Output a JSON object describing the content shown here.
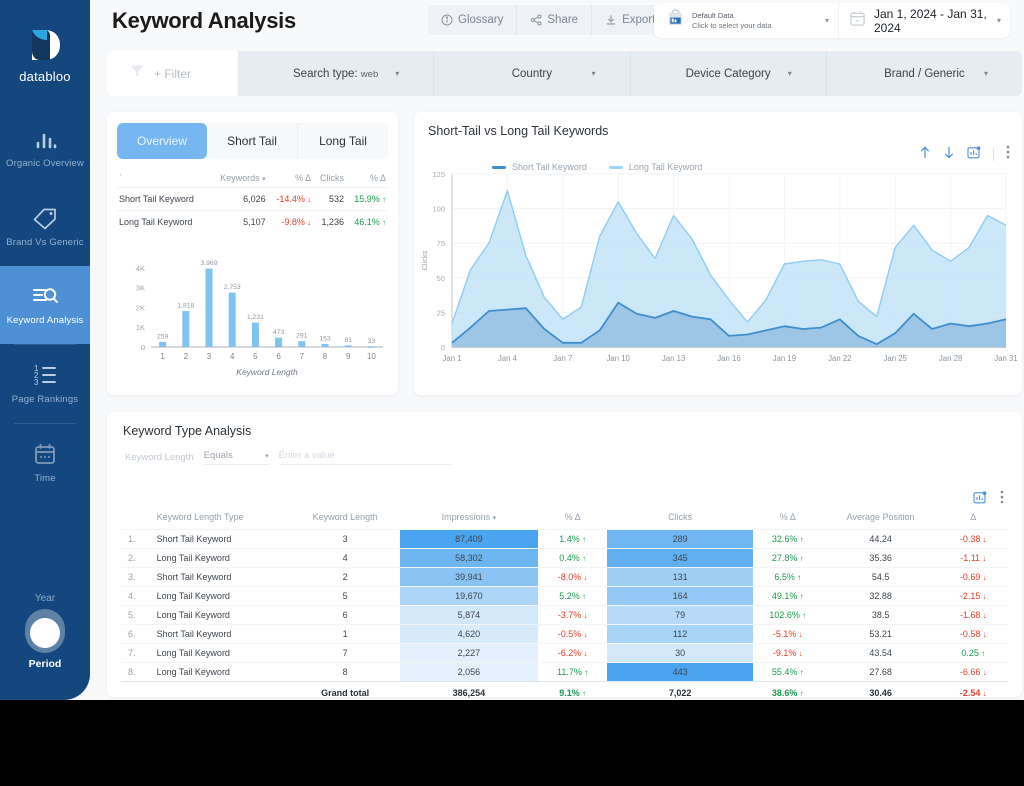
{
  "brand": {
    "name": "databloo",
    "logo_icon": "databloo-logo-icon"
  },
  "sidebar": {
    "items": [
      {
        "label": "Organic Overview",
        "icon": "bar-chart-icon",
        "active": false
      },
      {
        "label": "Brand Vs Generic",
        "icon": "tag-icon",
        "active": false
      },
      {
        "label": "Keyword Analysis",
        "icon": "keyword-search-icon",
        "active": true
      },
      {
        "label": "Page Rankings",
        "icon": "numbered-list-icon",
        "active": false
      },
      {
        "label": "Time",
        "icon": "calendar-icon",
        "active": false
      }
    ],
    "period": {
      "year_label": "Year",
      "period_label": "Period",
      "toggle_icon": "toggle-switch-icon"
    }
  },
  "header": {
    "title": "Keyword Analysis",
    "actions": [
      {
        "label": "Glossary",
        "icon": "info-circle-icon"
      },
      {
        "label": "Share",
        "icon": "share-icon"
      },
      {
        "label": "Export",
        "icon": "download-icon"
      }
    ],
    "data_source": {
      "icon": "data-source-icon",
      "title": "Default Data",
      "subtitle": "Click to select your data",
      "caret": "▾"
    },
    "date_range": {
      "icon": "calendar-icon",
      "value": "Jan 1, 2024 - Jan 31, 2024",
      "caret": "▾"
    }
  },
  "filter_bar": {
    "filter_chip": {
      "label": "+ Filter",
      "icon": "funnel-icon"
    },
    "segments": [
      {
        "label": "Search type:",
        "value": "web",
        "caret": "▾"
      },
      {
        "label": "Country",
        "value": "",
        "caret": "▾"
      },
      {
        "label": "Device Category",
        "value": "",
        "caret": "▾"
      },
      {
        "label": "Brand / Generic",
        "value": "",
        "caret": "▾"
      }
    ]
  },
  "left_card": {
    "tabs": [
      {
        "label": "Overview",
        "active": true
      },
      {
        "label": "Short Tail",
        "active": false
      },
      {
        "label": "Long Tail",
        "active": false
      }
    ],
    "summary_table": {
      "columns": [
        "",
        "Keywords",
        "% Δ",
        "Clicks",
        "% Δ"
      ],
      "sort_col": "Keywords",
      "rows": [
        {
          "type": "Short Tail Keyword",
          "keywords": "6,026",
          "kw_delta": "-14.4%",
          "kw_dir": "down",
          "clicks": "532",
          "clicks_delta": "15.9%",
          "clicks_dir": "up"
        },
        {
          "type": "Long Tail Keyword",
          "keywords": "5,107",
          "kw_delta": "-9.8%",
          "kw_dir": "down",
          "clicks": "1,236",
          "clicks_delta": "46.1%",
          "clicks_dir": "up"
        }
      ]
    }
  },
  "right_card": {
    "title": "Short-Tail vs Long Tail Keywords",
    "tools": [
      {
        "icon": "arrow-up-icon"
      },
      {
        "icon": "arrow-down-icon"
      },
      {
        "icon": "chart-export-icon"
      },
      {
        "icon": "more-vertical-icon"
      }
    ]
  },
  "bottom_card": {
    "title": "Keyword Type Analysis",
    "filter": {
      "label": "Keyword Length",
      "operator": "Equals",
      "caret": "▾",
      "value_placeholder": "Enter a value"
    },
    "tools": [
      {
        "icon": "chart-export-icon"
      },
      {
        "icon": "more-vertical-icon"
      }
    ],
    "table": {
      "columns": [
        "",
        "Keyword Length Type",
        "Keyword Length",
        "Impressions",
        "% Δ",
        "Clicks",
        "% Δ",
        "Average Position",
        "Δ"
      ],
      "sort_col": "Impressions",
      "rows": [
        {
          "idx": "1.",
          "type": "Short Tail Keyword",
          "len": "3",
          "impressions": "87,409",
          "imp_delta": "1.4%",
          "imp_dir": "up",
          "clicks": "289",
          "clk_delta": "32.6%",
          "clk_dir": "up",
          "avg_pos": "44.24",
          "pos_delta": "-0.38",
          "pos_dir": "down"
        },
        {
          "idx": "2.",
          "type": "Long Tail Keyword",
          "len": "4",
          "impressions": "58,302",
          "imp_delta": "0.4%",
          "imp_dir": "up",
          "clicks": "345",
          "clk_delta": "27.8%",
          "clk_dir": "up",
          "avg_pos": "35.36",
          "pos_delta": "-1.11",
          "pos_dir": "down"
        },
        {
          "idx": "3.",
          "type": "Short Tail Keyword",
          "len": "2",
          "impressions": "39,941",
          "imp_delta": "-8.0%",
          "imp_dir": "down",
          "clicks": "131",
          "clk_delta": "6.5%",
          "clk_dir": "up",
          "avg_pos": "54.5",
          "pos_delta": "-0.69",
          "pos_dir": "down"
        },
        {
          "idx": "4.",
          "type": "Long Tail Keyword",
          "len": "5",
          "impressions": "19,670",
          "imp_delta": "5.2%",
          "imp_dir": "up",
          "clicks": "164",
          "clk_delta": "49.1%",
          "clk_dir": "up",
          "avg_pos": "32.88",
          "pos_delta": "-2.15",
          "pos_dir": "down"
        },
        {
          "idx": "5.",
          "type": "Long Tail Keyword",
          "len": "6",
          "impressions": "5,874",
          "imp_delta": "-3.7%",
          "imp_dir": "down",
          "clicks": "79",
          "clk_delta": "102.6%",
          "clk_dir": "up",
          "avg_pos": "38.5",
          "pos_delta": "-1.68",
          "pos_dir": "down"
        },
        {
          "idx": "6.",
          "type": "Short Tail Keyword",
          "len": "1",
          "impressions": "4,620",
          "imp_delta": "-0.5%",
          "imp_dir": "down",
          "clicks": "112",
          "clk_delta": "-5.1%",
          "clk_dir": "down",
          "avg_pos": "53.21",
          "pos_delta": "-0.58",
          "pos_dir": "down"
        },
        {
          "idx": "7.",
          "type": "Long Tail Keyword",
          "len": "7",
          "impressions": "2,227",
          "imp_delta": "-6.2%",
          "imp_dir": "down",
          "clicks": "30",
          "clk_delta": "-9.1%",
          "clk_dir": "down",
          "avg_pos": "43.54",
          "pos_delta": "0.25",
          "pos_dir": "up"
        },
        {
          "idx": "8.",
          "type": "Long Tail Keyword",
          "len": "8",
          "impressions": "2,056",
          "imp_delta": "11.7%",
          "imp_dir": "up",
          "clicks": "443",
          "clk_delta": "55.4%",
          "clk_dir": "up",
          "avg_pos": "27.68",
          "pos_delta": "-6.66",
          "pos_dir": "down"
        }
      ],
      "total": {
        "label": "Grand total",
        "impressions": "386,254",
        "imp_delta": "9.1%",
        "imp_dir": "up",
        "clicks": "7,022",
        "clk_delta": "38.6%",
        "clk_dir": "up",
        "avg_pos": "30.46",
        "pos_delta": "-2.54",
        "pos_dir": "down"
      }
    }
  },
  "colors": {
    "sidebar": "#13477d",
    "sidebar_active": "#4e90d4",
    "accent": "#76b7f2",
    "short_tail_line": "#3f8fce",
    "short_tail_fill": "#a9cbe8",
    "long_tail_line": "#8fcdf2",
    "long_tail_fill": "#cfe6f7",
    "bar": "#7ec4ef",
    "up": "#1a9c4e",
    "down": "#e0402c",
    "page_bg": "#f7f9fb"
  },
  "chart_data": [
    {
      "type": "bar",
      "title": "",
      "xlabel": "Keyword Length",
      "ylabel": "",
      "categories": [
        "1",
        "2",
        "3",
        "4",
        "5",
        "6",
        "7",
        "8",
        "9",
        "10"
      ],
      "values": [
        259,
        1818,
        3969,
        2753,
        1231,
        473,
        291,
        153,
        81,
        33
      ],
      "value_labels": [
        "259",
        "1,818",
        "3,969",
        "2,753",
        "1,231",
        "473",
        "291",
        "153",
        "81",
        "33"
      ],
      "ytick_labels": [
        "0",
        "1K",
        "2K",
        "3K",
        "4K"
      ],
      "ytick_values": [
        0,
        1000,
        2000,
        3000,
        4000
      ],
      "ylim": [
        0,
        4200
      ],
      "grid": false,
      "legend": "none"
    },
    {
      "type": "area",
      "title": "Short-Tail vs Long Tail Keywords",
      "xlabel": "",
      "ylabel": "Clicks",
      "ytick_labels": [
        "0",
        "25",
        "50",
        "75",
        "100",
        "125"
      ],
      "ytick_values": [
        0,
        25,
        50,
        75,
        100,
        125
      ],
      "ylim": [
        0,
        125
      ],
      "grid": true,
      "legend": "top-left",
      "xtick_labels": [
        "Jan 1",
        "Jan 4",
        "Jan 7",
        "Jan 10",
        "Jan 13",
        "Jan 16",
        "Jan 19",
        "Jan 22",
        "Jan 25",
        "Jan 28",
        "Jan 31"
      ],
      "x": [
        "Jan 1",
        "Jan 2",
        "Jan 3",
        "Jan 4",
        "Jan 5",
        "Jan 6",
        "Jan 7",
        "Jan 8",
        "Jan 9",
        "Jan 10",
        "Jan 11",
        "Jan 12",
        "Jan 13",
        "Jan 14",
        "Jan 15",
        "Jan 16",
        "Jan 17",
        "Jan 18",
        "Jan 19",
        "Jan 20",
        "Jan 21",
        "Jan 22",
        "Jan 23",
        "Jan 24",
        "Jan 25",
        "Jan 26",
        "Jan 27",
        "Jan 28",
        "Jan 29",
        "Jan 30",
        "Jan 31"
      ],
      "series": [
        {
          "name": "Long Tail Keyword",
          "color": "#8fcdf2",
          "values": [
            17,
            56,
            75,
            113,
            66,
            36,
            20,
            29,
            80,
            105,
            82,
            64,
            95,
            78,
            52,
            34,
            18,
            34,
            60,
            62,
            63,
            60,
            33,
            22,
            72,
            88,
            70,
            62,
            72,
            95,
            88
          ]
        },
        {
          "name": "Short Tail Keyword",
          "color": "#3f8fce",
          "values": [
            3,
            14,
            26,
            27,
            28,
            13,
            3,
            3,
            12,
            32,
            24,
            21,
            26,
            22,
            20,
            8,
            9,
            12,
            15,
            13,
            14,
            20,
            8,
            2,
            10,
            24,
            13,
            17,
            15,
            17,
            20
          ]
        }
      ]
    }
  ]
}
